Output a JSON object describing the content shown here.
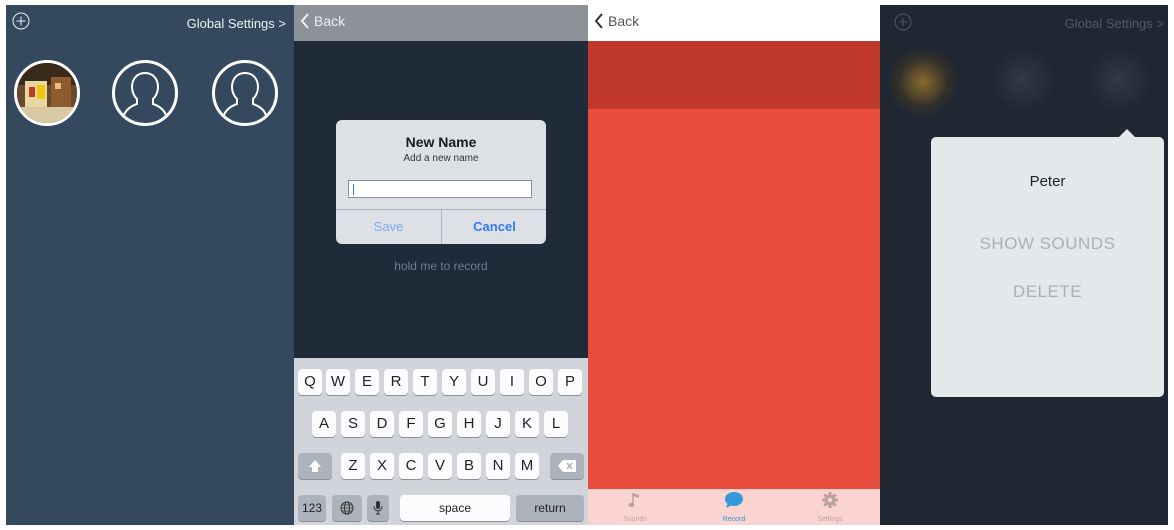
{
  "screen1": {
    "add_icon": "plus-circle-icon",
    "settings_link": "Global Settings >"
  },
  "screen2": {
    "back_label": "Back",
    "dialog": {
      "title": "New Name",
      "subtitle": "Add a new name",
      "input_value": "",
      "save_label": "Save",
      "cancel_label": "Cancel"
    },
    "hint": "hold me to record",
    "keyboard": {
      "row1": [
        "Q",
        "W",
        "E",
        "R",
        "T",
        "Y",
        "U",
        "I",
        "O",
        "P"
      ],
      "row2": [
        "A",
        "S",
        "D",
        "F",
        "G",
        "H",
        "J",
        "K",
        "L"
      ],
      "row3": [
        "Z",
        "X",
        "C",
        "V",
        "B",
        "N",
        "M"
      ],
      "numbers_label": "123",
      "space_label": "space",
      "return_label": "return"
    }
  },
  "screen3": {
    "back_label": "Back",
    "tabs": [
      {
        "label": "Sounds",
        "icon": "music-note-icon"
      },
      {
        "label": "Record",
        "icon": "speech-bubble-icon"
      },
      {
        "label": "Settings",
        "icon": "gear-icon"
      }
    ],
    "active_tab": "Record"
  },
  "screen4": {
    "settings_link": "Global Settings >",
    "menu": {
      "name": "Peter",
      "show_sounds_label": "SHOW SOUNDS",
      "delete_label": "DELETE"
    }
  },
  "colors": {
    "panel_blue": "#34495e",
    "record_red": "#e74c3c",
    "accent_blue": "#3478f6"
  }
}
